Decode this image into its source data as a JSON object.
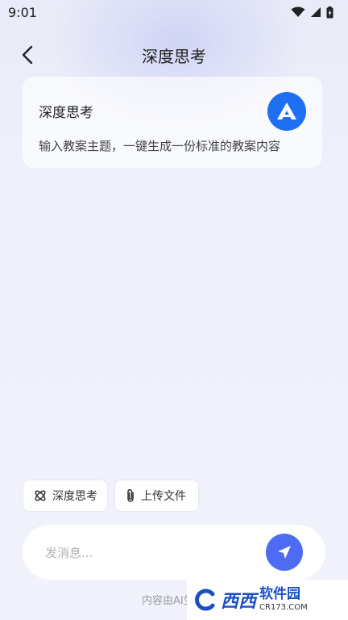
{
  "status_bar": {
    "time": "9:01"
  },
  "header": {
    "title": "深度思考"
  },
  "intro_card": {
    "title": "深度思考",
    "description": "输入教案主题，一键生成一份标准的教案内容"
  },
  "chips": {
    "deep_think": "深度思考",
    "upload_file": "上传文件"
  },
  "composer": {
    "placeholder": "发消息...",
    "value": ""
  },
  "disclaimer": "内容由AI生成",
  "watermark": {
    "main": "西西",
    "sub": "软件园",
    "url": "CR173.COM"
  },
  "colors": {
    "accent": "#4d6cf2",
    "logo": "#1f6ff2"
  }
}
